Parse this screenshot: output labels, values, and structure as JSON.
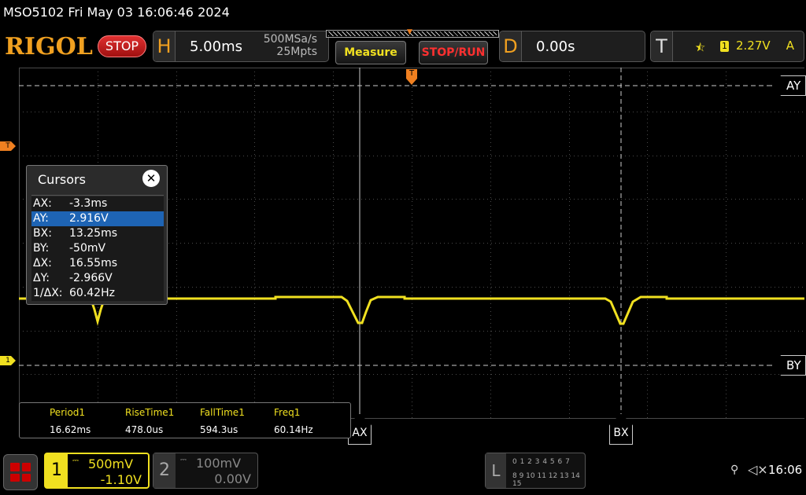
{
  "title_bar": {
    "text": "MSO5102  Fri May 03 16:06:46 2024"
  },
  "header": {
    "logo": "RIGOL",
    "run_state": "STOP",
    "horizontal": {
      "letter": "H",
      "timebase": "5.00ms",
      "sample_rate": "500MSa/s",
      "memory_depth": "25Mpts"
    },
    "buttons": {
      "measure": "Measure",
      "stop_run": "STOP/RUN"
    },
    "delay": {
      "letter": "D",
      "value": "0.00s"
    },
    "trigger": {
      "letter": "T",
      "edge_icon": "rising-edge-icon",
      "source": "1",
      "level": "2.27V",
      "coupling": "A"
    }
  },
  "markers": {
    "trigger_level": "T",
    "ch1_ground": "1",
    "trigger_position": "T"
  },
  "cursors": {
    "panel_title": "Cursors",
    "close_icon": "✕",
    "rows": [
      {
        "label": "AX:",
        "value": "-3.3ms",
        "selected": false
      },
      {
        "label": "AY:",
        "value": "2.916V",
        "selected": true
      },
      {
        "label": "BX:",
        "value": "13.25ms",
        "selected": false
      },
      {
        "label": "BY:",
        "value": "-50mV",
        "selected": false
      },
      {
        "label": "ΔX:",
        "value": "16.55ms",
        "selected": false
      },
      {
        "label": "ΔY:",
        "value": "-2.966V",
        "selected": false
      },
      {
        "label": "1/ΔX:",
        "value": "60.42Hz",
        "selected": false
      }
    ],
    "tags": {
      "ay": "AY",
      "by": "BY",
      "ax": "AX",
      "bx": "BX"
    }
  },
  "measurements": [
    {
      "name": "Period1",
      "value": "16.62ms"
    },
    {
      "name": "RiseTime1",
      "value": "478.0us"
    },
    {
      "name": "FallTime1",
      "value": "594.3us"
    },
    {
      "name": "Freq1",
      "value": "60.14Hz"
    }
  ],
  "channels": {
    "ch1": {
      "number": "1",
      "coupling_icon": "dc-coupling-icon",
      "scale": "500mV",
      "offset": "-1.10V"
    },
    "ch2": {
      "number": "2",
      "coupling_icon": "dc-coupling-icon",
      "scale": "100mV",
      "offset": "0.00V"
    }
  },
  "logic_analyzer": {
    "letter": "L",
    "row1": "0 1 2 3   4 5 6 7",
    "row2": "8 9 10 11  12 13 14 15"
  },
  "status": {
    "clock": "16:06",
    "usb_icon": "usb-icon",
    "sound_icon": "speaker-muted-icon"
  },
  "colors": {
    "ch1": "#f0e020",
    "trigger": "#f08020",
    "stop": "#d02020",
    "selection": "#1e64b4"
  }
}
